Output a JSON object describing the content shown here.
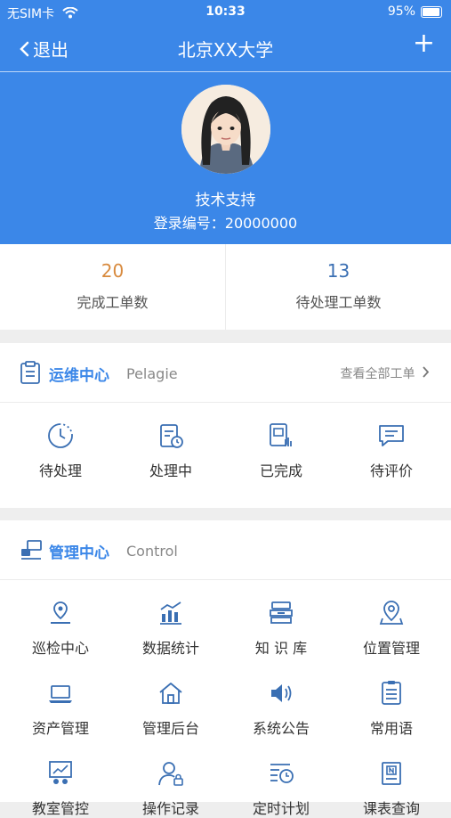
{
  "status": {
    "carrier": "无SIM卡",
    "time": "10:33",
    "battery": "95%"
  },
  "nav": {
    "back": "退出",
    "title": "北京XX大学",
    "add": "+"
  },
  "profile": {
    "name": "技术支持",
    "id": "登录编号：20000000"
  },
  "stats": [
    {
      "value": "20",
      "label": "完成工单数",
      "color": "#d88a3e"
    },
    {
      "value": "13",
      "label": "待处理工单数",
      "color": "#3a6fb3"
    }
  ],
  "ops": {
    "title": "运维中心",
    "subtitle": "Pelagie",
    "more": "查看全部工单",
    "items": [
      {
        "label": "待处理",
        "icon": "clock-icon"
      },
      {
        "label": "处理中",
        "icon": "processing-icon"
      },
      {
        "label": "已完成",
        "icon": "completed-icon"
      },
      {
        "label": "待评价",
        "icon": "comment-icon"
      }
    ]
  },
  "mgmt": {
    "title": "管理中心",
    "subtitle": "Control",
    "items": [
      {
        "label": "巡检中心",
        "icon": "location-pin-icon"
      },
      {
        "label": "数据统计",
        "icon": "chart-icon"
      },
      {
        "label": "知 识 库",
        "icon": "books-icon"
      },
      {
        "label": "位置管理",
        "icon": "map-pin-icon"
      },
      {
        "label": "资产管理",
        "icon": "laptop-icon"
      },
      {
        "label": "管理后台",
        "icon": "home-icon"
      },
      {
        "label": "系统公告",
        "icon": "speaker-icon"
      },
      {
        "label": "常用语",
        "icon": "list-icon"
      },
      {
        "label": "教室管控",
        "icon": "classroom-icon"
      },
      {
        "label": "操作记录",
        "icon": "user-lock-icon"
      },
      {
        "label": "定时计划",
        "icon": "schedule-icon"
      },
      {
        "label": "课表查询",
        "icon": "notebook-icon"
      }
    ]
  },
  "theme": {
    "primary": "#3b87e8",
    "icon": "#3a6fb3"
  }
}
